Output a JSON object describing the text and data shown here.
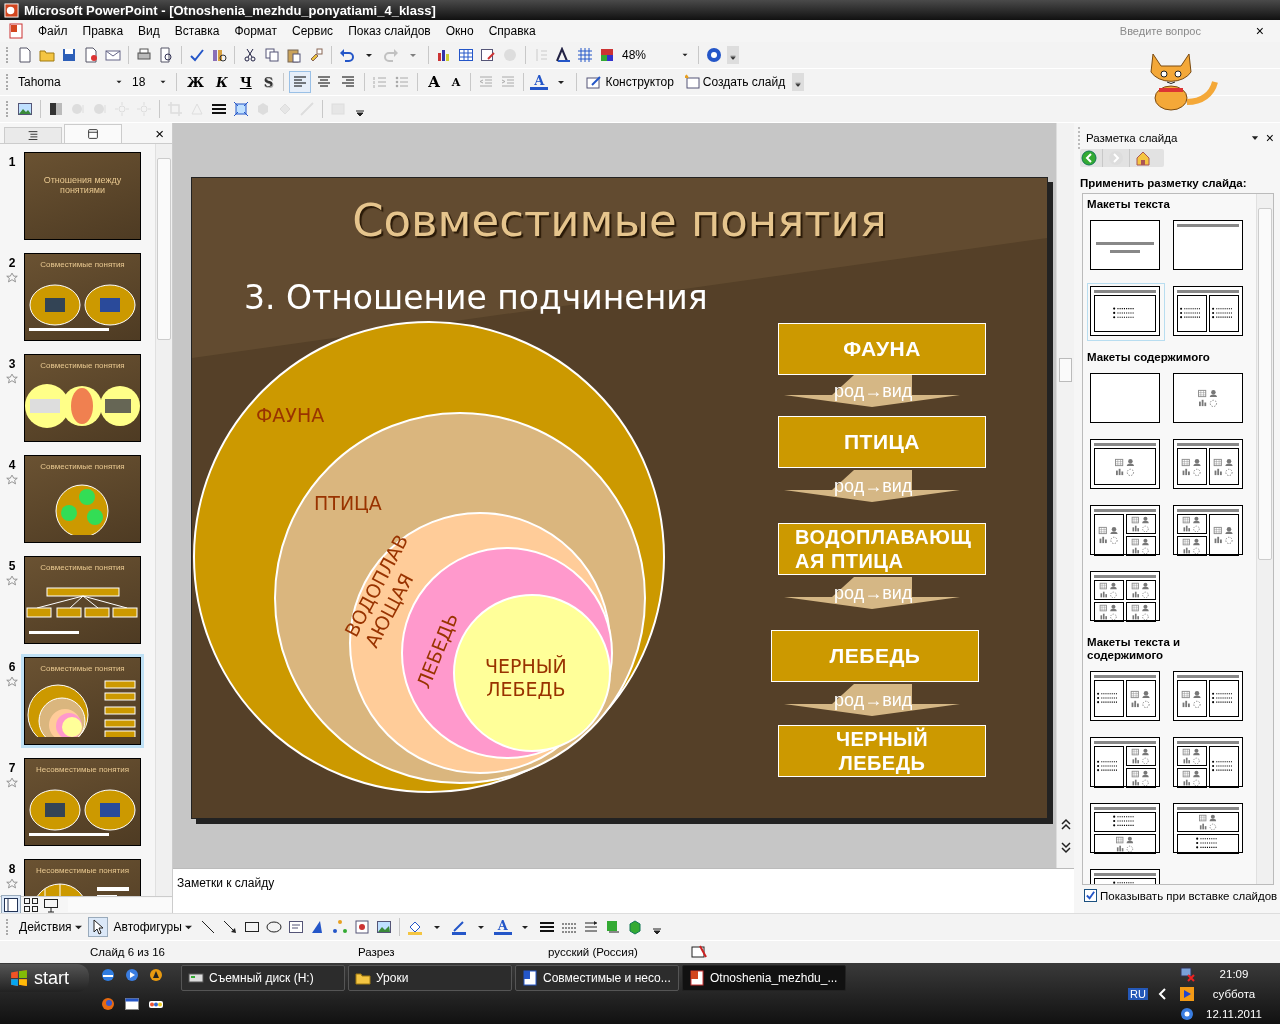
{
  "window": {
    "title": "Microsoft PowerPoint - [Otnoshenia_mezhdu_ponyatiami_4_klass]"
  },
  "menu": [
    "Файл",
    "Правка",
    "Вид",
    "Вставка",
    "Формат",
    "Сервис",
    "Показ слайдов",
    "Окно",
    "Справка"
  ],
  "help_search": {
    "placeholder": "Введите вопрос"
  },
  "menu_close": "×",
  "panel_close": "×",
  "standard_toolbar": {
    "zoom": "48%"
  },
  "formatting_toolbar": {
    "font": "Tahoma",
    "size": "18",
    "styles": [
      {
        "label": "Ж"
      },
      {
        "label": "К"
      },
      {
        "label": "Ч"
      },
      {
        "label": "S"
      }
    ],
    "alignments": [
      {
        "selected": true
      },
      {
        "selected": false
      },
      {
        "selected": false
      }
    ],
    "grow_font": "A",
    "shrink_font": "A",
    "font_color": "A",
    "design": "Конструктор",
    "new_slide": "Создать слайд"
  },
  "outline_tabs": [
    {
      "selected": false
    },
    {
      "selected": true
    }
  ],
  "slides": [
    {
      "number": "1",
      "title": "Отношения между понятиями",
      "kind": "title",
      "animated": false,
      "selected": false
    },
    {
      "number": "2",
      "title": "Совместимые понятия",
      "kind": "two-ovals",
      "animated": true,
      "selected": false
    },
    {
      "number": "3",
      "title": "Совместимые понятия",
      "kind": "three-circles",
      "animated": true,
      "selected": false
    },
    {
      "number": "4",
      "title": "Совместимые понятия",
      "kind": "circle-photos",
      "animated": true,
      "selected": false
    },
    {
      "number": "5",
      "title": "Совместимые понятия",
      "kind": "tree",
      "animated": true,
      "selected": false
    },
    {
      "number": "6",
      "title": "Совместимые понятия",
      "kind": "nested-circles",
      "animated": true,
      "selected": true
    },
    {
      "number": "7",
      "title": "Несовместимые понятия",
      "kind": "two-ovals",
      "animated": true,
      "selected": false
    },
    {
      "number": "8",
      "title": "Несовместимые понятия",
      "kind": "pie",
      "animated": true,
      "selected": false
    }
  ],
  "slide": {
    "title": "Совместимые понятия",
    "subtitle": "3. Отношение подчинения",
    "circles": [
      {
        "lines": [
          "ФАУНА"
        ],
        "color": "#cc9900"
      },
      {
        "lines": [
          "ПТИЦА"
        ],
        "color": "#dab67e"
      },
      {
        "lines": [
          "ВОДОПЛАВ",
          "АЮЩАЯ"
        ],
        "color": "#ffcc99"
      },
      {
        "lines": [
          "ЛЕБЕДЬ"
        ],
        "color": "#ff99cc"
      },
      {
        "lines": [
          "ЧЕРНЫЙ",
          "ЛЕБЕДЬ"
        ],
        "color": "#ffff99"
      }
    ],
    "chain": [
      {
        "lines": [
          "ФАУНА"
        ]
      },
      {
        "lines": [
          "ПТИЦА"
        ]
      },
      {
        "lines": [
          "ВОДОПЛАВАЮЩ",
          "АЯ  ПТИЦА"
        ]
      },
      {
        "lines": [
          "ЛЕБЕДЬ"
        ]
      },
      {
        "lines": [
          "ЧЕРНЫЙ",
          "ЛЕБЕДЬ"
        ]
      }
    ],
    "connectors": [
      "род→вид",
      "род→вид",
      "род→вид",
      "род→вид"
    ]
  },
  "notes": {
    "placeholder": "Заметки к слайду"
  },
  "task_pane": {
    "title": "Разметка слайда",
    "close": "×",
    "heading": "Применить разметку слайда:",
    "sections": [
      {
        "title": "Макеты текста",
        "layouts": [
          {
            "kind": "title",
            "selected": false
          },
          {
            "kind": "title-only",
            "selected": false
          },
          {
            "kind": "bullets",
            "selected": true
          },
          {
            "kind": "two-bullets",
            "selected": false
          }
        ]
      },
      {
        "title": "Макеты содержимого",
        "layouts": [
          {
            "kind": "blank",
            "selected": false
          },
          {
            "kind": "content",
            "selected": false
          },
          {
            "kind": "title-content",
            "selected": false
          },
          {
            "kind": "title-2content",
            "selected": false
          },
          {
            "kind": "title-content-2content",
            "selected": false
          },
          {
            "kind": "title-2content-content",
            "selected": false
          },
          {
            "kind": "title-4content",
            "selected": false
          }
        ]
      },
      {
        "title": "Макеты текста и содержимого",
        "layouts": [
          {
            "kind": "text-content",
            "selected": false
          },
          {
            "kind": "content-text",
            "selected": false
          },
          {
            "kind": "text-2content",
            "selected": false
          },
          {
            "kind": "twocontent-text",
            "selected": false
          },
          {
            "kind": "text-over-content",
            "selected": false
          },
          {
            "kind": "content-over-text",
            "selected": false
          },
          {
            "kind": "text-over-content",
            "selected": false
          }
        ]
      }
    ],
    "show_on_insert": {
      "label": "Показывать при вставке слайдов",
      "checked": true
    }
  },
  "drawing_toolbar": {
    "actions": "Действия",
    "autoshapes": "Автофигуры",
    "font_color": "A"
  },
  "status_bar": [
    "Слайд 6 из 16",
    "Разрез",
    "русский (Россия)"
  ],
  "taskbar": {
    "start": "start",
    "tasks": [
      {
        "label": "Съемный диск (H:)",
        "selected": false
      },
      {
        "label": "Уроки",
        "selected": false
      },
      {
        "label": "Совместимые и несо...",
        "selected": false
      },
      {
        "label": "Otnoshenia_mezhdu_...",
        "selected": true
      }
    ],
    "language": "RU",
    "time": "21:09",
    "day": "суббота",
    "date": "12.11.2011"
  }
}
